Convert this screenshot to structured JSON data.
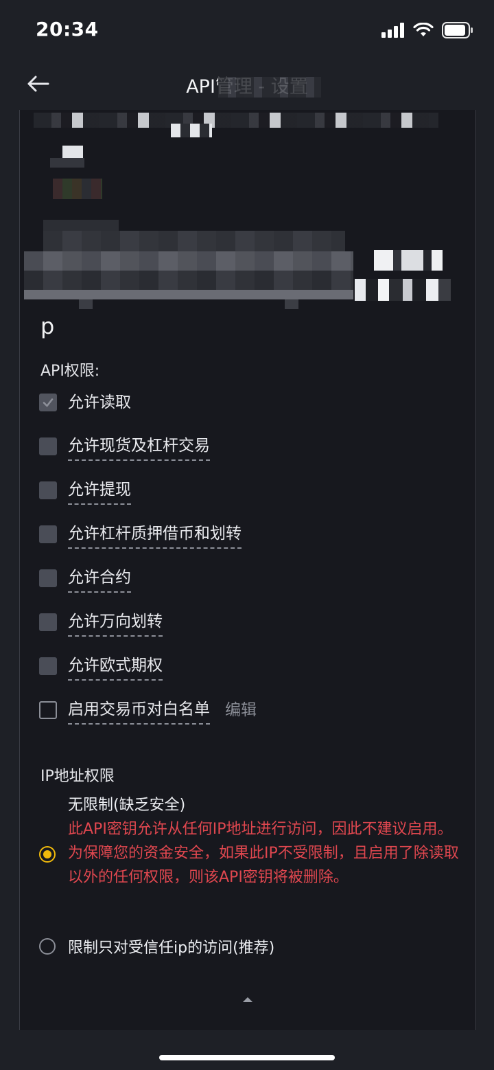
{
  "status_bar": {
    "time": "20:34"
  },
  "header": {
    "title": "API管理 - 设置"
  },
  "key": {
    "suffix": "p"
  },
  "permissions": {
    "label": "API权限:",
    "items": [
      {
        "label": "允许读取",
        "checked": true,
        "disabled": true
      },
      {
        "label": "允许现货及杠杆交易",
        "checked": false
      },
      {
        "label": "允许提现",
        "checked": false
      },
      {
        "label": "允许杠杆质押借币和划转",
        "checked": false
      },
      {
        "label": "允许合约",
        "checked": false
      },
      {
        "label": "允许万向划转",
        "checked": false
      },
      {
        "label": "允许欧式期权",
        "checked": false
      },
      {
        "label": "启用交易币对白名单",
        "checked": false,
        "edit_label": "编辑"
      }
    ]
  },
  "ip": {
    "label": "IP地址权限",
    "options": [
      {
        "title": "无限制(缺乏安全)",
        "warning1": "此API密钥允许从任何IP地址进行访问，因此不建议启用。",
        "warning2": "为保障您的资金安全，如果此IP不受限制，且启用了除读取以外的任何权限，则该API密钥将被删除。",
        "selected": true
      },
      {
        "title": "限制只对受信任ip的访问(推荐)",
        "selected": false
      }
    ]
  },
  "colors": {
    "accent": "#f0b90b",
    "warning": "#e0474f",
    "background": "#1e2026",
    "card": "#17181e"
  }
}
